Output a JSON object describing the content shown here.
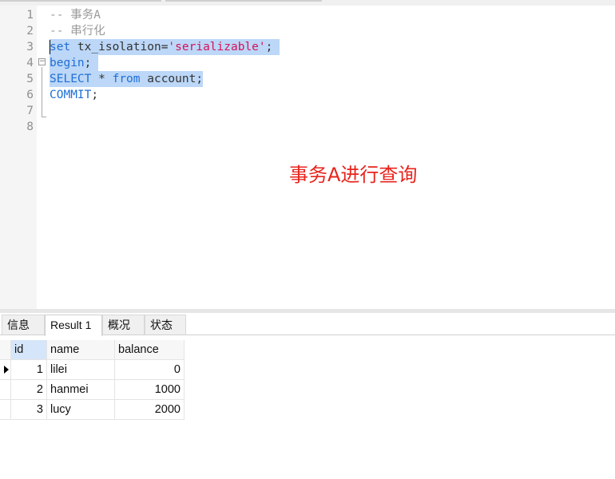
{
  "editor": {
    "lines": [
      {
        "num": "1"
      },
      {
        "num": "2"
      },
      {
        "num": "3"
      },
      {
        "num": "4"
      },
      {
        "num": "5"
      },
      {
        "num": "6"
      },
      {
        "num": "7"
      },
      {
        "num": "8"
      }
    ],
    "code": {
      "l1": "-- 事务A",
      "l2": "-- 串行化",
      "l3_kw": "set",
      "l3_a": " tx_isolation=",
      "l3_str": "'serializable'",
      "l3_b": ";",
      "l4_kw": "begin",
      "l4_b": ";",
      "l5_kw1": "SELECT",
      "l5_a": " * ",
      "l5_kw2": "from",
      "l5_b": " account;",
      "l6_kw": "COMMIT",
      "l6_b": ";"
    },
    "fold_symbol": "−"
  },
  "annotation": "事务A进行查询",
  "result_tabs": [
    {
      "label": "信息",
      "active": false
    },
    {
      "label": "Result 1",
      "active": true
    },
    {
      "label": "概况",
      "active": false
    },
    {
      "label": "状态",
      "active": false
    }
  ],
  "grid": {
    "columns": [
      "id",
      "name",
      "balance"
    ],
    "rows": [
      {
        "id": "1",
        "name": "lilei",
        "balance": "0"
      },
      {
        "id": "2",
        "name": "hanmei",
        "balance": "1000"
      },
      {
        "id": "3",
        "name": "lucy",
        "balance": "2000"
      }
    ]
  },
  "colors": {
    "keyword": "#1f6fd6",
    "string": "#d4135a",
    "comment": "#9a9a9a",
    "selection": "#bcd7f7",
    "annotation": "#e8231c"
  }
}
